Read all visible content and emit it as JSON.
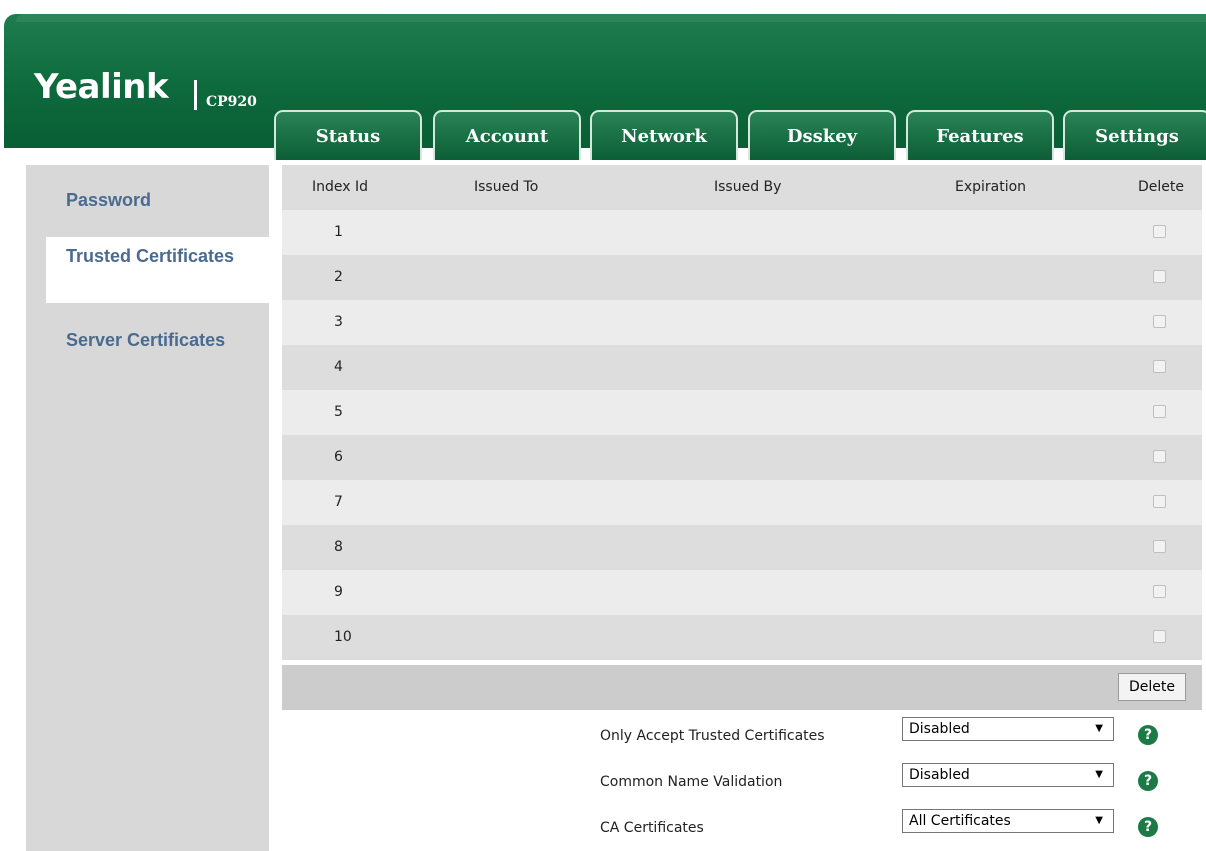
{
  "brand": {
    "logo": "Yealink",
    "model": "CP920"
  },
  "tabs": [
    {
      "label": "Status"
    },
    {
      "label": "Account"
    },
    {
      "label": "Network"
    },
    {
      "label": "Dsskey"
    },
    {
      "label": "Features"
    },
    {
      "label": "Settings"
    }
  ],
  "sidebar": {
    "items": [
      {
        "label": "Password"
      },
      {
        "label": "Trusted Certificates"
      },
      {
        "label": "Server Certificates"
      }
    ],
    "active": "Trusted Certificates"
  },
  "table": {
    "headers": [
      "Index Id",
      "Issued To",
      "Issued By",
      "Expiration",
      "Delete"
    ],
    "rows": [
      {
        "index": "1"
      },
      {
        "index": "2"
      },
      {
        "index": "3"
      },
      {
        "index": "4"
      },
      {
        "index": "5"
      },
      {
        "index": "6"
      },
      {
        "index": "7"
      },
      {
        "index": "8"
      },
      {
        "index": "9"
      },
      {
        "index": "10"
      }
    ],
    "delete_button": "Delete"
  },
  "settings": [
    {
      "label": "Only Accept Trusted Certificates",
      "value": "Disabled",
      "help": "?"
    },
    {
      "label": "Common Name Validation",
      "value": "Disabled",
      "help": "?"
    },
    {
      "label": "CA Certificates",
      "value": "All Certificates",
      "help": "?"
    }
  ],
  "colors": {
    "header_green": "#0d6a3d",
    "sidebar_gray": "#d8d8d8",
    "link_blue": "#4a6b8f"
  }
}
